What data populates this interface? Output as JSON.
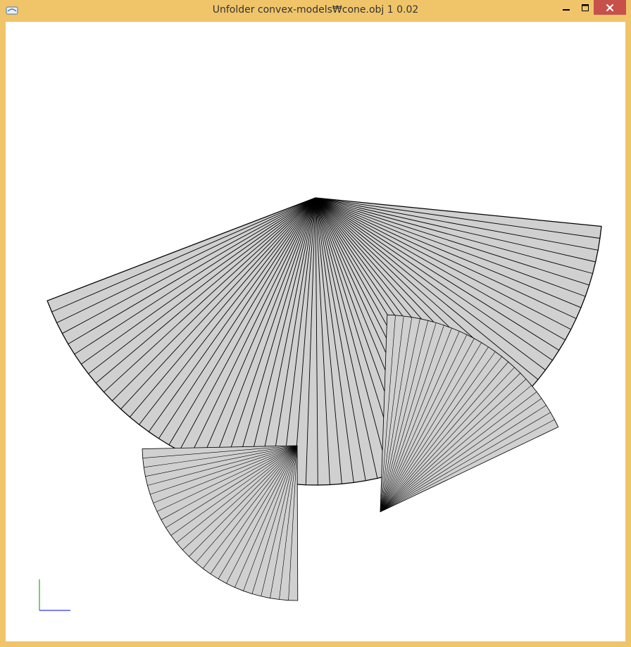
{
  "window": {
    "title": "Unfolder convex-models₩cone.obj 1 0.02",
    "frame_color": "#f0c56a",
    "close_color": "#c7504b"
  },
  "controls": {
    "minimize": "minimize-icon",
    "maximize": "maximize-icon",
    "close": "close-icon"
  },
  "viewport": {
    "background": "#ffffff",
    "face_fill": "#d0d0d0",
    "edge_color": "#000000"
  },
  "axis": {
    "x_color": "#3333ff",
    "y_color": "#22aa22"
  }
}
